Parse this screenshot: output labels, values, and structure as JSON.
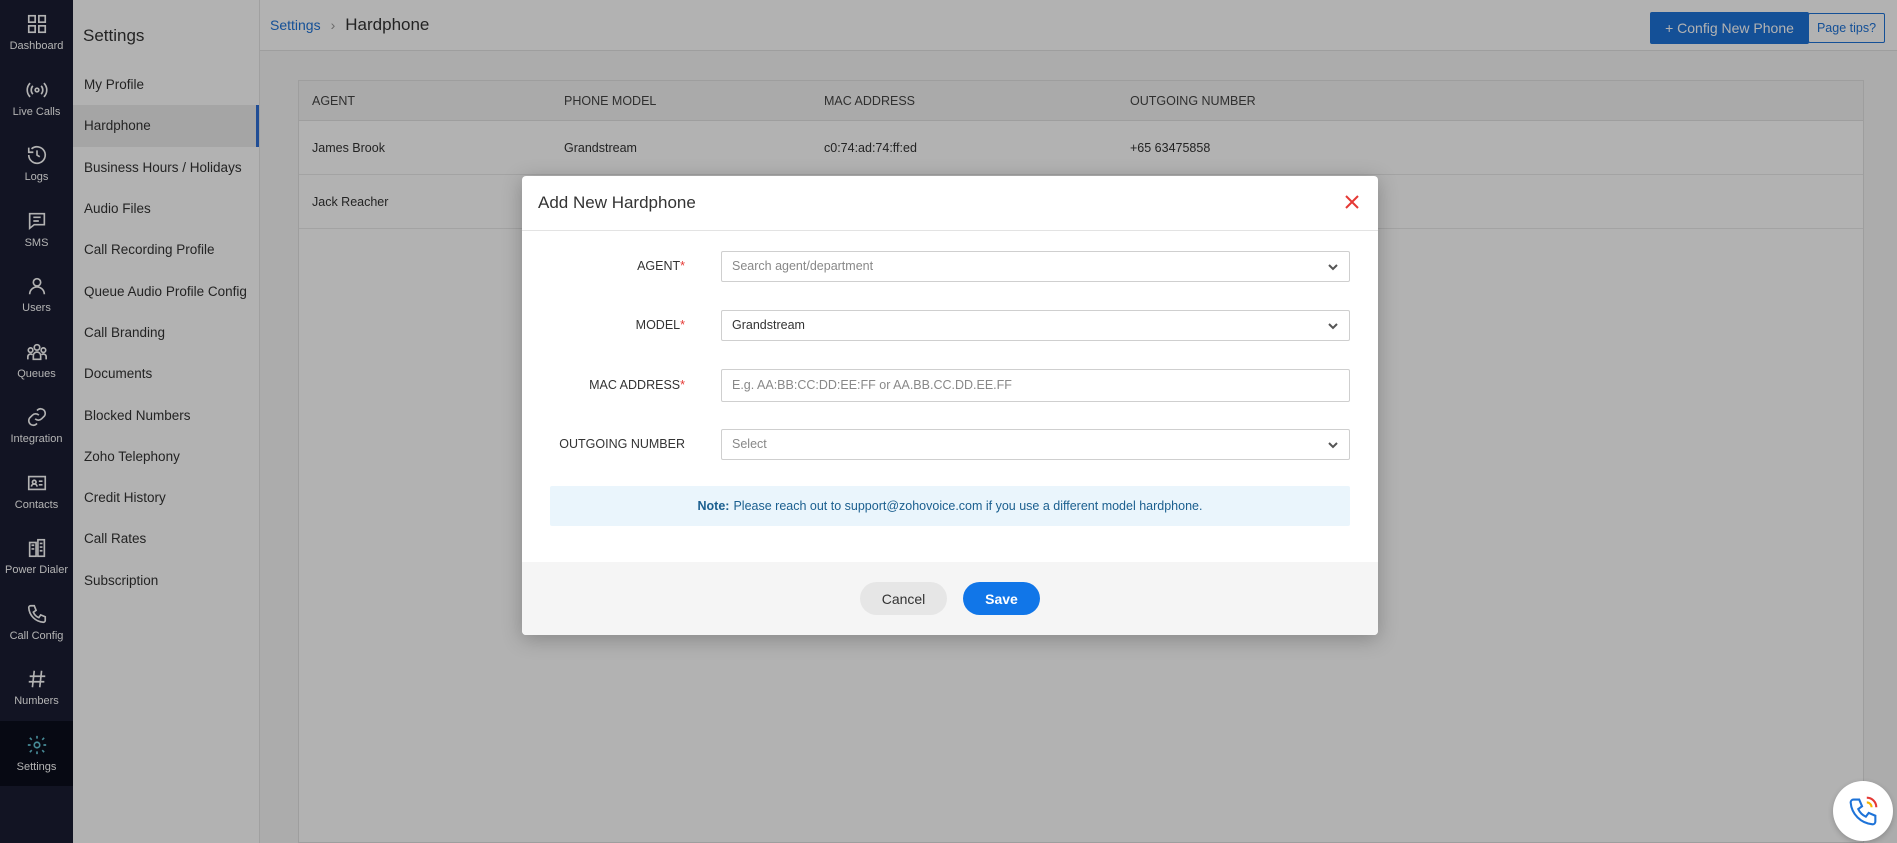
{
  "nav": {
    "items": [
      {
        "label": "Dashboard",
        "icon": "grid-icon"
      },
      {
        "label": "Live Calls",
        "icon": "broadcast-icon"
      },
      {
        "label": "Logs",
        "icon": "history-icon"
      },
      {
        "label": "SMS",
        "icon": "message-icon"
      },
      {
        "label": "Users",
        "icon": "user-icon"
      },
      {
        "label": "Queues",
        "icon": "group-icon"
      },
      {
        "label": "Integration",
        "icon": "link-icon"
      },
      {
        "label": "Contacts",
        "icon": "contact-card-icon"
      },
      {
        "label": "Power Dialer",
        "icon": "building-icon"
      },
      {
        "label": "Call Config",
        "icon": "phone-icon"
      },
      {
        "label": "Numbers",
        "icon": "hash-icon"
      },
      {
        "label": "Settings",
        "icon": "gear-icon",
        "active": true
      }
    ]
  },
  "settings_menu": {
    "title": "Settings",
    "items": [
      {
        "label": "My Profile"
      },
      {
        "label": "Hardphone",
        "active": true
      },
      {
        "label": "Business Hours / Holidays"
      },
      {
        "label": "Audio Files"
      },
      {
        "label": "Call Recording Profile"
      },
      {
        "label": "Queue Audio Profile Config"
      },
      {
        "label": "Call Branding"
      },
      {
        "label": "Documents"
      },
      {
        "label": "Blocked Numbers"
      },
      {
        "label": "Zoho Telephony"
      },
      {
        "label": "Credit History"
      },
      {
        "label": "Call Rates"
      },
      {
        "label": "Subscription"
      }
    ]
  },
  "header": {
    "breadcrumb_parent": "Settings",
    "breadcrumb_current": "Hardphone",
    "config_button": "+ Config New Phone",
    "tips_button": "Page tips?"
  },
  "table": {
    "columns": [
      "AGENT",
      "PHONE MODEL",
      "MAC ADDRESS",
      "OUTGOING NUMBER"
    ],
    "rows": [
      [
        "James Brook",
        "Grandstream",
        "c0:74:ad:74:ff:ed",
        "+65 63475858"
      ],
      [
        "Jack Reacher",
        "",
        "",
        ""
      ]
    ]
  },
  "modal": {
    "title": "Add New Hardphone",
    "agent_label": "AGENT",
    "agent_placeholder": "Search agent/department",
    "model_label": "MODEL",
    "model_value": "Grandstream",
    "mac_label": "MAC ADDRESS",
    "mac_placeholder": "E.g. AA:BB:CC:DD:EE:FF or AA.BB.CC.DD.EE.FF",
    "outgoing_label": "OUTGOING NUMBER",
    "outgoing_placeholder": "Select",
    "required_mark": "*",
    "note_prefix": "Note:",
    "note_text": "Please reach out to support@zohovoice.com if you use a different model hardphone.",
    "cancel": "Cancel",
    "save": "Save"
  },
  "colors": {
    "nav_bg": "#1b1e33",
    "accent": "#1e73d8",
    "save": "#1176e8",
    "required": "#e53935"
  }
}
